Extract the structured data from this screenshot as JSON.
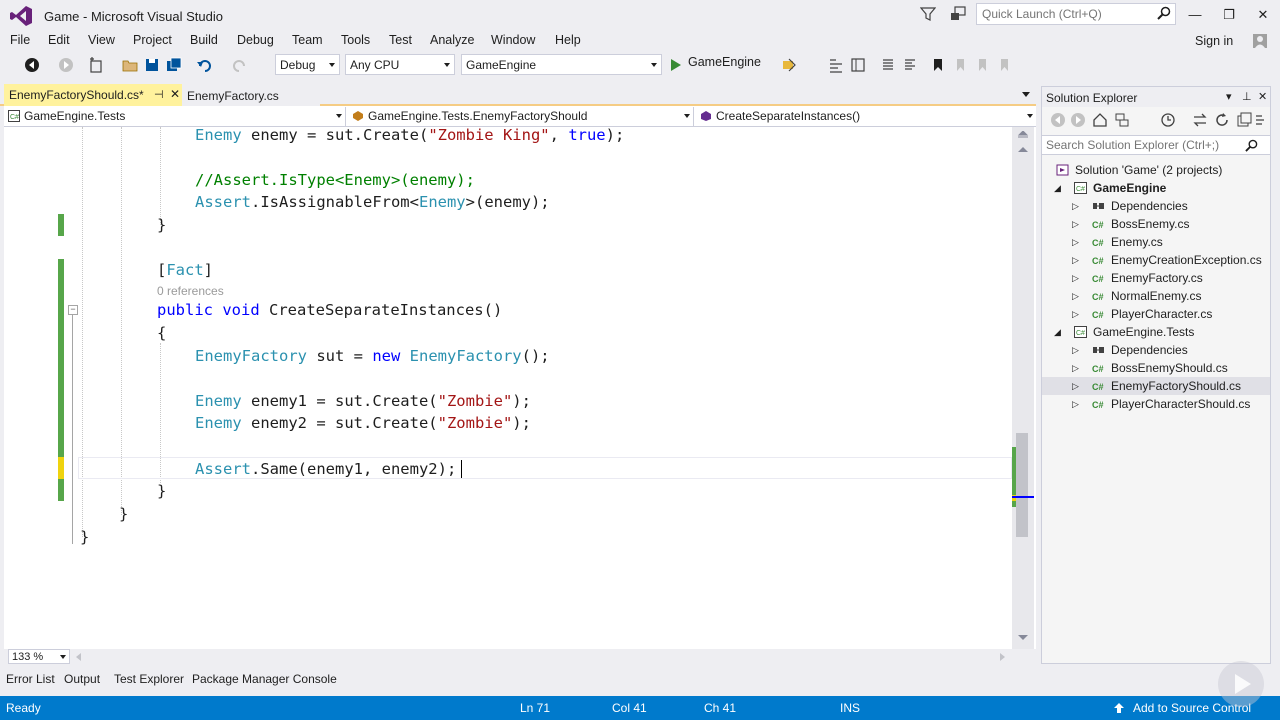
{
  "window": {
    "title": "Game - Microsoft Visual Studio",
    "quick_launch_placeholder": "Quick Launch (Ctrl+Q)",
    "minimize": "—",
    "restore": "❐",
    "close": "✕"
  },
  "menu": [
    "File",
    "Edit",
    "View",
    "Project",
    "Build",
    "Debug",
    "Team",
    "Tools",
    "Test",
    "Analyze",
    "Window",
    "Help"
  ],
  "signin": "Sign in",
  "toolbar": {
    "config": "Debug",
    "platform": "Any CPU",
    "startup_project": "GameEngine",
    "run_label": "GameEngine"
  },
  "tabs": {
    "active": "EnemyFactoryShould.cs*",
    "inactive": "EnemyFactory.cs",
    "pin": "⊣",
    "close": "✕"
  },
  "navbar": {
    "project": "GameEngine.Tests",
    "type": "GameEngine.Tests.EnemyFactoryShould",
    "member": "CreateSeparateInstances()"
  },
  "code": {
    "l1": {
      "t1": "Enemy",
      "t2": " enemy = sut.Create(",
      "t3": "\"Zombie King\"",
      "t4": ", ",
      "t5": "true",
      "t6": ");"
    },
    "l2": {
      "c": "//Assert.IsType<Enemy>(enemy);"
    },
    "l3": {
      "t1": "Assert",
      "t2": ".IsAssignableFrom<",
      "t3": "Enemy",
      "t4": ">(enemy);"
    },
    "l4": "}",
    "l5": {
      "b1": "[",
      "a": "Fact",
      "b2": "]"
    },
    "refs": "0 references",
    "l6": {
      "k1": "public",
      "s1": " ",
      "k2": "void",
      "rest": " CreateSeparateInstances()"
    },
    "l7": "{",
    "l8": {
      "t1": "EnemyFactory",
      "t2": " sut = ",
      "k": "new",
      "s": " ",
      "t3": "EnemyFactory",
      "t4": "();"
    },
    "l9": {
      "t1": "Enemy",
      "t2": " enemy1 = sut.Create(",
      "t3": "\"Zombie\"",
      "t4": ");"
    },
    "l10": {
      "t1": "Enemy",
      "t2": " enemy2 = sut.Create(",
      "t3": "\"Zombie\"",
      "t4": ");"
    },
    "l11": {
      "t1": "Assert",
      "t2": ".Same(enemy1, enemy2);"
    },
    "l12": "}",
    "l13": "}",
    "l14": "}"
  },
  "zoom": "133 %",
  "solution_explorer": {
    "title": "Solution Explorer",
    "search_placeholder": "Search Solution Explorer (Ctrl+;)",
    "solution": "Solution 'Game' (2 projects)",
    "projects": [
      {
        "name": "GameEngine",
        "items": [
          "Dependencies",
          "BossEnemy.cs",
          "Enemy.cs",
          "EnemyCreationException.cs",
          "EnemyFactory.cs",
          "NormalEnemy.cs",
          "PlayerCharacter.cs"
        ]
      },
      {
        "name": "GameEngine.Tests",
        "items": [
          "Dependencies",
          "BossEnemyShould.cs",
          "EnemyFactoryShould.cs",
          "PlayerCharacterShould.cs"
        ]
      }
    ]
  },
  "tool_tabs": [
    "Error List",
    "Output",
    "Test Explorer",
    "Package Manager Console"
  ],
  "status": {
    "ready": "Ready",
    "ln": "Ln 71",
    "col": "Col 41",
    "ch": "Ch 41",
    "ins": "INS",
    "source_control": "Add to Source Control"
  },
  "colors": {
    "accent": "#007acc",
    "tab_active": "#fff29d",
    "keyword": "#0000ff",
    "type": "#2b91af",
    "string": "#a31515",
    "comment": "#008000",
    "change_saved": "#57a64a",
    "change_unsaved": "#efd30e"
  }
}
